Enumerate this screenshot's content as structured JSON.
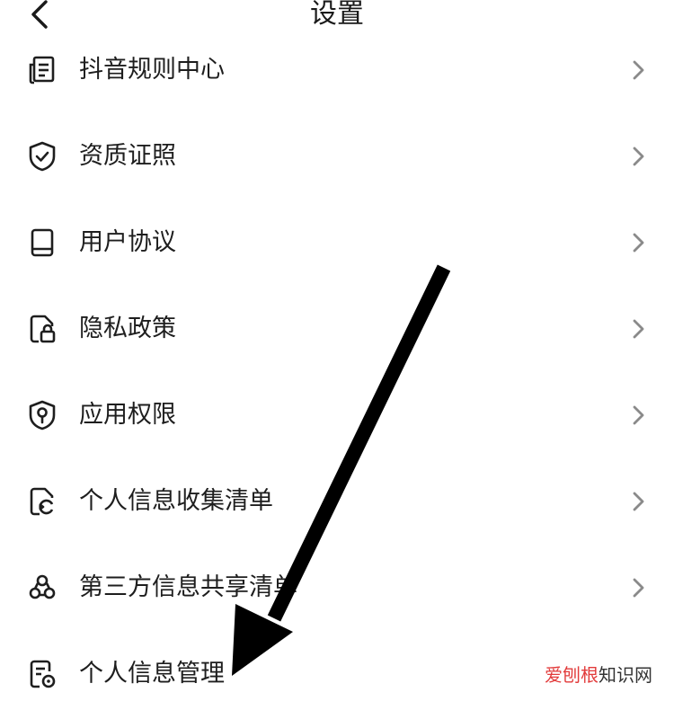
{
  "header": {
    "title": "设置",
    "back_icon": "chevron-left-icon"
  },
  "items": [
    {
      "label": "抖音规则中心",
      "icon": "document-list-icon"
    },
    {
      "label": "资质证照",
      "icon": "shield-check-icon"
    },
    {
      "label": "用户协议",
      "icon": "book-icon"
    },
    {
      "label": "隐私政策",
      "icon": "file-lock-icon"
    },
    {
      "label": "应用权限",
      "icon": "shield-key-icon"
    },
    {
      "label": "个人信息收集清单",
      "icon": "file-export-icon"
    },
    {
      "label": "第三方信息共享清单",
      "icon": "share-nodes-icon"
    },
    {
      "label": "个人信息管理",
      "icon": "file-settings-icon"
    }
  ],
  "watermark": {
    "part1": "爱刨根",
    "part2": "知识网"
  },
  "colors": {
    "text": "#1e1e1e",
    "chevron": "#8a8a8a",
    "arrow": "#000000",
    "watermark_red": "#e23b3b"
  }
}
